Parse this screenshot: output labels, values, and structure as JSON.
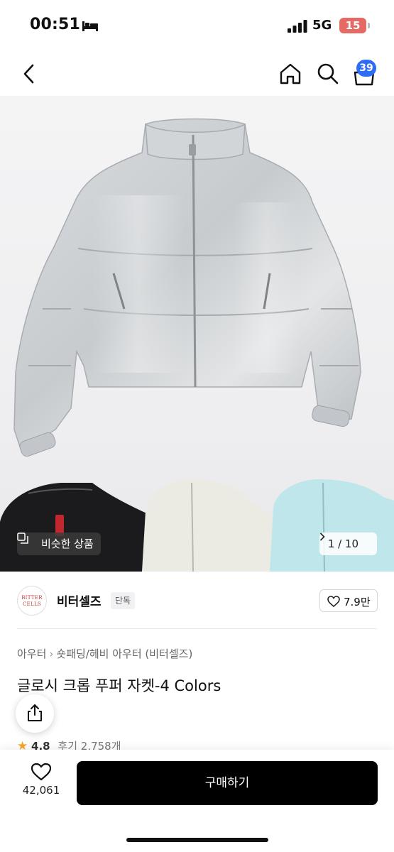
{
  "status_bar": {
    "time": "00:51",
    "network": "5G",
    "battery": "15"
  },
  "nav": {
    "cart_badge": "39"
  },
  "gallery": {
    "similar_label": "비슷한 상품",
    "pager": "1 / 10"
  },
  "brand": {
    "logo_text": "BITTER CELLS",
    "name": "비터셀즈",
    "tag": "단독",
    "likes": "7.9만"
  },
  "product": {
    "breadcrumb": [
      "아우터",
      "숏패딩/헤비 아우터 (비터셀즈)"
    ],
    "title": "글로시 크롭 푸퍼 자켓-4 Colors",
    "rating": "4.8",
    "reviews": "후기 2,758개"
  },
  "bottom": {
    "wish_count": "42,061",
    "buy_label": "구매하기"
  },
  "colors": {
    "badge": "#2f6cf5",
    "battery": "#e56a63",
    "star": "#f5a623",
    "buy_button": "#000000"
  },
  "icons": [
    "bed-icon",
    "signal-icon",
    "back-icon",
    "home-icon",
    "search-icon",
    "cart-icon",
    "similar-icon",
    "chevron-right-icon",
    "heart-icon",
    "share-icon",
    "star-icon"
  ]
}
